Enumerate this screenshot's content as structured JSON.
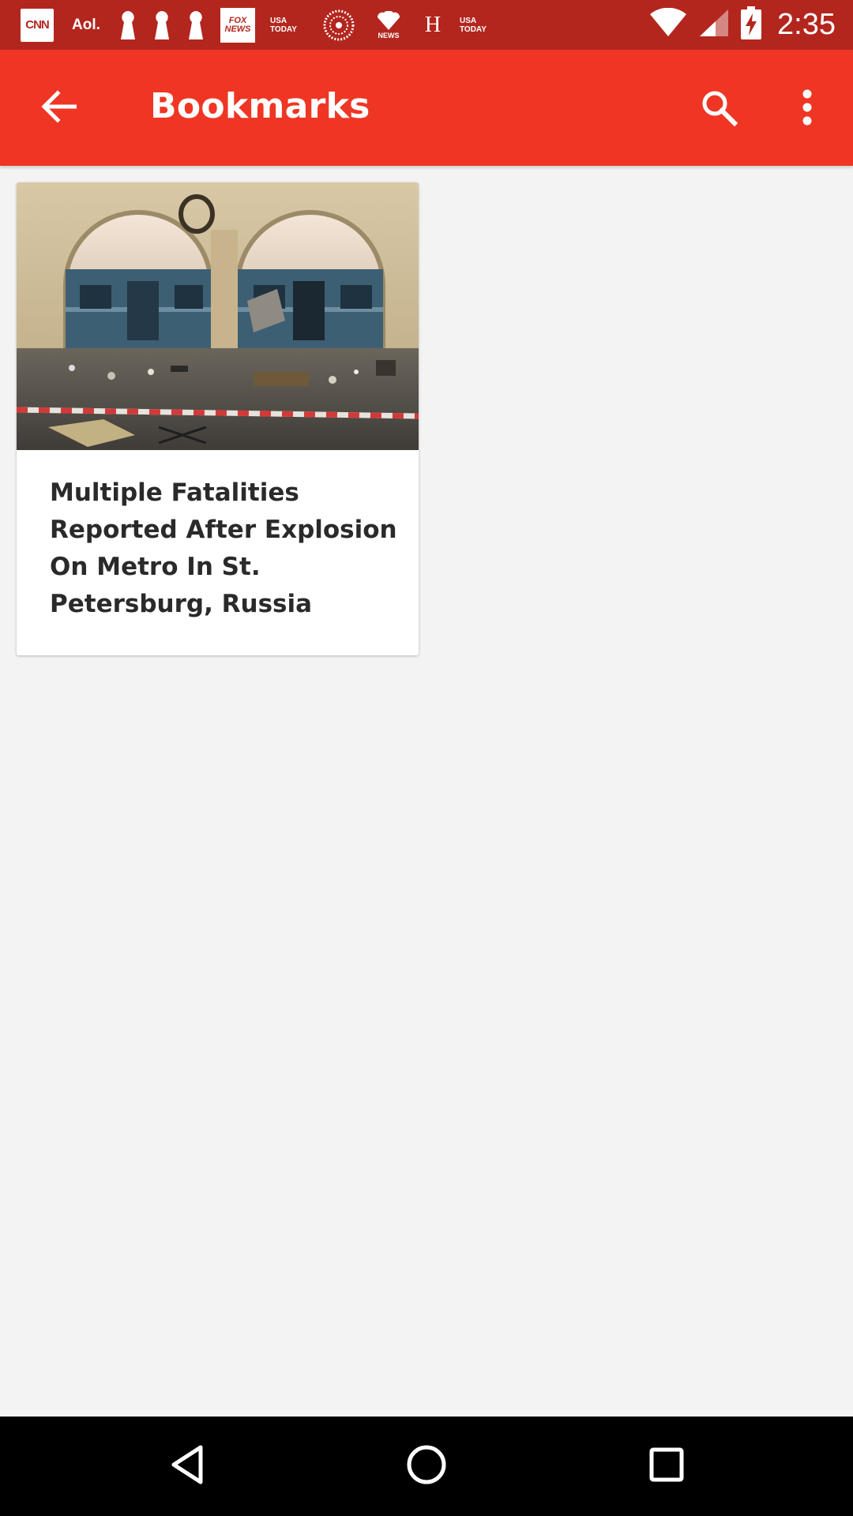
{
  "status_bar": {
    "time": "2:35",
    "notifications": [
      "CNN",
      "Aol.",
      "FOX NEWS",
      "USA TODAY",
      "NEWS",
      "H",
      "USA TODAY"
    ],
    "icons": [
      "wifi-icon",
      "cell-signal-icon",
      "battery-charging-icon"
    ]
  },
  "app_bar": {
    "title": "Bookmarks",
    "back_icon": "arrow-back-icon",
    "search_icon": "search-icon",
    "more_icon": "more-vert-icon",
    "color": "#ef3624"
  },
  "bookmarks": [
    {
      "title": "Multiple Fatalities Reported After Explosion On Metro In St. Petersburg, Russia",
      "image": "metro-station-train-photo"
    }
  ],
  "nav_bar": {
    "buttons": [
      "nav-back-icon",
      "nav-home-icon",
      "nav-recents-icon"
    ]
  },
  "colors": {
    "status_bar": "#b3261e",
    "app_bar": "#ef3624",
    "background": "#f3f3f3"
  }
}
